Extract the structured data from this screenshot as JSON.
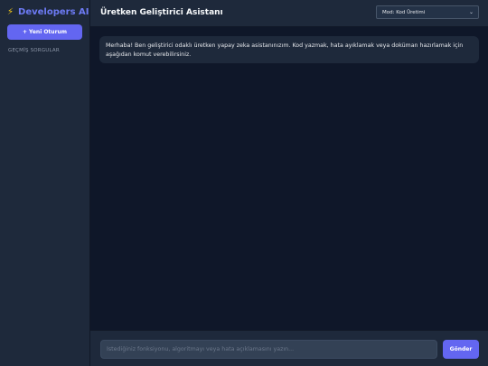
{
  "sidebar": {
    "brand_icon": "⚡",
    "brand_title": "Developers AI",
    "new_session_label": "+ Yeni Oturum",
    "history_label": "GEÇMİŞ SORGULAR"
  },
  "header": {
    "title": "Üretken Geliştirici Asistanı",
    "mode_selected": "Mod: Kod Üretimi"
  },
  "chat": {
    "messages": [
      {
        "role": "assistant",
        "text": "Merhaba! Ben geliştirici odaklı üretken yapay zeka asistanınızım. Kod yazmak, hata ayıklamak veya doküman hazırlamak için aşağıdan komut verebilirsiniz."
      }
    ]
  },
  "composer": {
    "placeholder": "İstediğiniz fonksiyonu, algoritmayı veya hata açıklamasını yazın...",
    "value": "",
    "send_label": "Gönder"
  },
  "colors": {
    "accent": "#6366f1",
    "sidebar_bg": "#1e293b",
    "main_bg": "#0f1729"
  }
}
